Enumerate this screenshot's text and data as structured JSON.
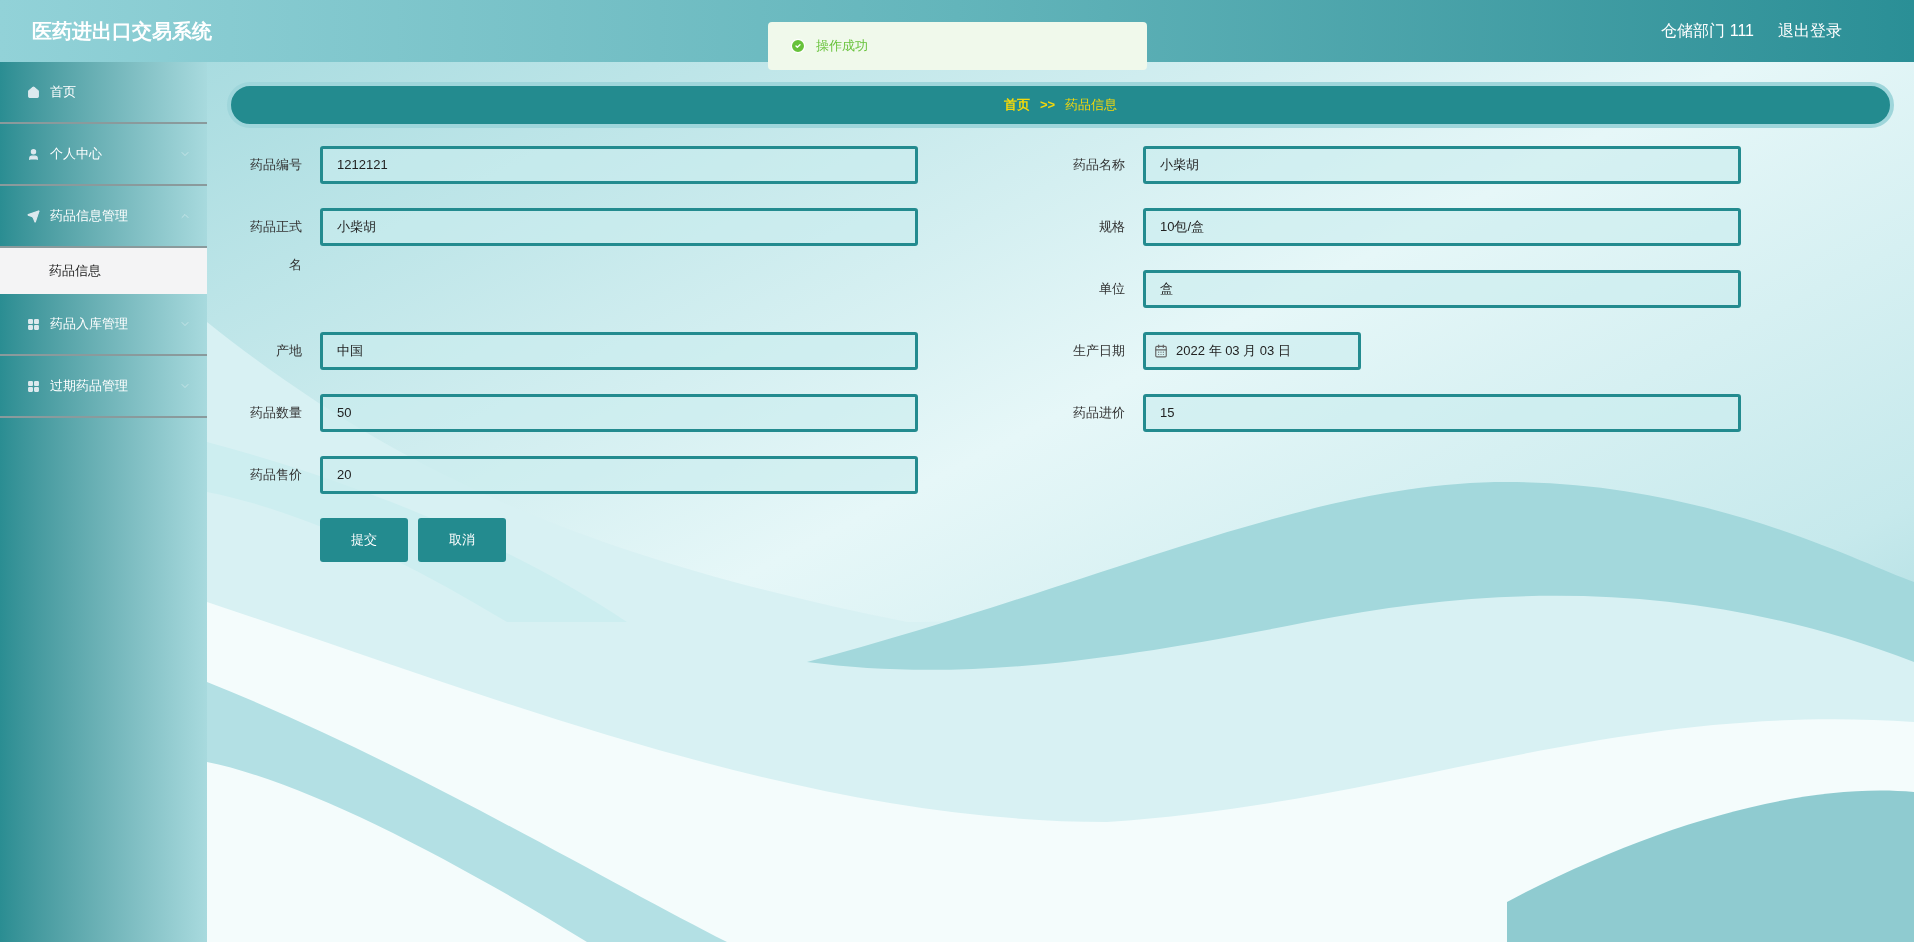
{
  "header": {
    "title": "医药进出口交易系统",
    "user": "仓储部门 111",
    "logout": "退出登录"
  },
  "toast": {
    "message": "操作成功"
  },
  "sidebar": {
    "items": [
      {
        "label": "首页",
        "kind": "link"
      },
      {
        "label": "个人中心",
        "kind": "submenu",
        "expanded": false
      },
      {
        "label": "药品信息管理",
        "kind": "submenu",
        "expanded": true,
        "children": [
          {
            "label": "药品信息",
            "selected": true
          }
        ]
      },
      {
        "label": "药品入库管理",
        "kind": "submenu",
        "expanded": false
      },
      {
        "label": "过期药品管理",
        "kind": "submenu",
        "expanded": false
      }
    ]
  },
  "breadcrumb": {
    "home": "首页",
    "separator": ">>",
    "current": "药品信息"
  },
  "form": {
    "left": [
      {
        "label": "药品编号",
        "value": "1212121",
        "kind": "text"
      },
      {
        "label": "药品正式名",
        "value": "小柴胡",
        "kind": "text"
      },
      {
        "label": "产地",
        "value": "中国",
        "kind": "text"
      },
      {
        "label": "药品数量",
        "value": "50",
        "kind": "text"
      },
      {
        "label": "药品售价",
        "value": "20",
        "kind": "text"
      }
    ],
    "right": [
      {
        "label": "药品名称",
        "value": "小柴胡",
        "kind": "text"
      },
      {
        "label": "规格",
        "value": "10包/盒",
        "kind": "text"
      },
      {
        "label": "单位",
        "value": "盒",
        "kind": "text"
      },
      {
        "label": "生产日期",
        "value": "2022 年 03 月 03 日",
        "kind": "date"
      },
      {
        "label": "药品进价",
        "value": "15",
        "kind": "text"
      }
    ],
    "buttons": [
      "提交",
      "取消"
    ]
  }
}
